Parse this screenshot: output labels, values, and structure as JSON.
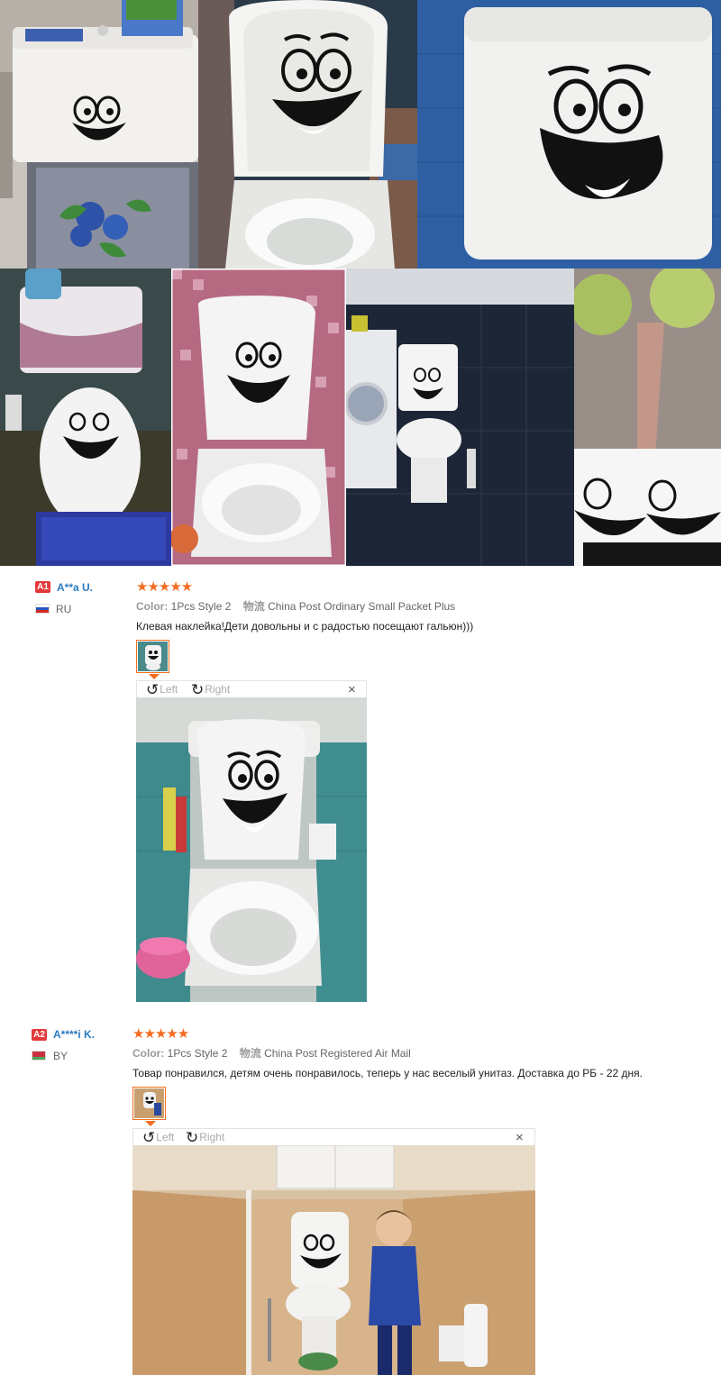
{
  "gallery": {
    "photos": [
      {
        "label": "toilet-tank-sticker"
      },
      {
        "label": "toilet-lid-sticker"
      },
      {
        "label": "tank-closeup-sticker"
      },
      {
        "label": "green-bathroom-sticker"
      },
      {
        "label": "mosaic-bathroom-sticker"
      },
      {
        "label": "dark-tile-bathroom-sticker"
      },
      {
        "label": "packaged-stickers"
      }
    ]
  },
  "reviews": [
    {
      "badge": "A1",
      "name": "A**a U.",
      "country": "RU",
      "flag_colors": [
        "#ffffff",
        "#2a52be",
        "#d52b1e"
      ],
      "stars": "★★★★★",
      "color_label": "Color:",
      "color_value": "1Pcs Style 2",
      "shipping_label": "物流",
      "shipping_value": "China Post Ordinary Small Packet Plus",
      "text": "Клевая наклейка!Дети довольны и с радостью посещают гальюн)))",
      "left_label": "Left",
      "right_label": "Right",
      "close_label": "×"
    },
    {
      "badge": "A2",
      "name": "A****i K.",
      "country": "BY",
      "flag_colors": [
        "#c8313e",
        "#c8313e",
        "#4aa657"
      ],
      "stars": "★★★★★",
      "color_label": "Color:",
      "color_value": "1Pcs Style 2",
      "shipping_label": "物流",
      "shipping_value": "China Post Registered Air Mail",
      "text": "Товар понравился, детям очень понравилось, теперь у нас веселый унитаз. Доставка до РБ - 22 дня.",
      "left_label": "Left",
      "right_label": "Right",
      "close_label": "×"
    }
  ],
  "colors": {
    "accent": "#f36c20",
    "name": "#2b7bc0",
    "badge": "#e4393c"
  }
}
